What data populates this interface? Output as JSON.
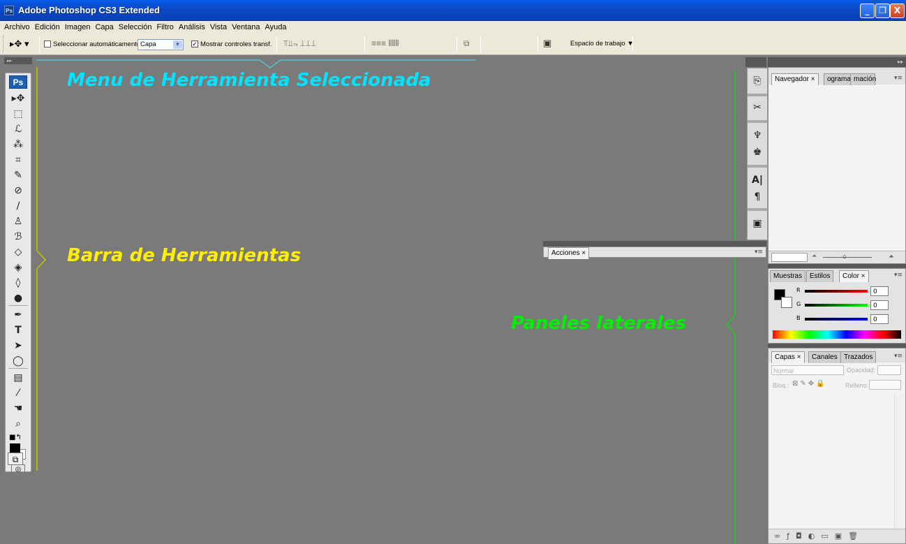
{
  "window": {
    "app_icon": "Ps",
    "title": "Adobe Photoshop CS3 Extended",
    "minimize": "_",
    "maximize": "❐",
    "close": "X"
  },
  "menu": [
    "Archivo",
    "Edición",
    "Imagen",
    "Capa",
    "Selección",
    "Filtro",
    "Análisis",
    "Vista",
    "Ventana",
    "Ayuda"
  ],
  "options_bar": {
    "auto_select_label": "Seleccionar automáticamente:",
    "auto_select_value": "Capa",
    "show_transform_label": "Mostrar controles transf.",
    "workspace_label": "Espacio de trabajo ▼",
    "auto_select_checked": false,
    "show_transform_checked": true
  },
  "toolbox": {
    "badge": "Ps",
    "tools": [
      "move-tool",
      "marquee-tool",
      "lasso-tool",
      "magic-wand-tool",
      "crop-tool",
      "eyedropper-slice-tool",
      "healing-brush-tool",
      "brush-tool",
      "clone-stamp-tool",
      "history-brush-tool",
      "eraser-tool",
      "paint-bucket-tool",
      "blur-tool",
      "dodge-tool",
      "pen-tool",
      "type-tool",
      "path-selection-tool",
      "shape-tool",
      "notes-tool",
      "eyedropper-tool",
      "hand-tool",
      "zoom-tool"
    ]
  },
  "annotations": {
    "tool_menu": "Menu de Herramienta Seleccionada",
    "toolbar": "Barra de Herramientas",
    "side_panels": "Paneles laterales"
  },
  "panels": {
    "actions_tab": "Acciones ×",
    "navigator_tabs": [
      "Navegador ×",
      "ograma",
      "mación"
    ],
    "color_tabs": [
      "Muestras",
      "Estilos",
      "Color ×"
    ],
    "color_labels": [
      "R",
      "G",
      "B"
    ],
    "color_values": [
      "0",
      "0",
      "0"
    ],
    "layers_tabs": [
      "Capas ×",
      "Canales",
      "Trazados"
    ],
    "blend_mode": "Normal",
    "opacity_label": "Opacidad:",
    "lock_label": "Bloq.:",
    "fill_label": "Relleno:"
  },
  "colors": {
    "canvas_bg": "#7a7a7a",
    "title_blue": "#0a5ee8",
    "annotation_cyan": "#00e5ff",
    "annotation_yellow": "#ffef00",
    "annotation_green": "#00f000"
  }
}
